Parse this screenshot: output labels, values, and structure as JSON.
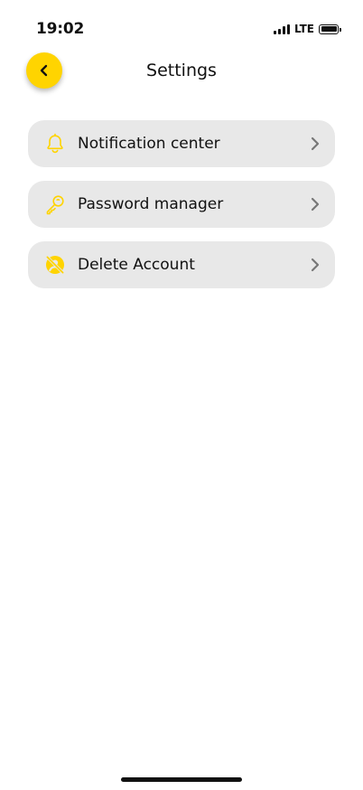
{
  "status_bar": {
    "time": "19:02",
    "network": "LTE"
  },
  "header": {
    "title": "Settings",
    "back_icon": "chevron-left-icon"
  },
  "menu": {
    "items": [
      {
        "label": "Notification center",
        "icon": "bell-icon"
      },
      {
        "label": "Password manager",
        "icon": "key-icon"
      },
      {
        "label": "Delete Account",
        "icon": "delete-account-icon"
      }
    ]
  },
  "colors": {
    "accent": "#FFD400",
    "item_background": "#E8E8E8",
    "chevron": "#777777",
    "text": "#111111"
  }
}
